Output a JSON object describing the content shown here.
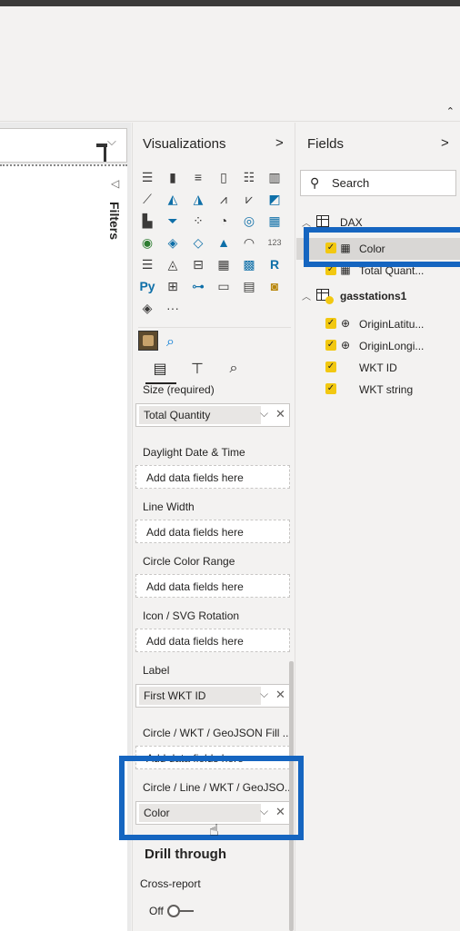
{
  "ribbon": {
    "collapse_icon": "chevron-up-icon"
  },
  "filters": {
    "label": "Filters",
    "caret_icon": "chevron-left-icon"
  },
  "visualizations": {
    "title": "Visualizations",
    "chevron_icon": "chevron-right-icon",
    "more_label": "···",
    "search_icon": "search-icon",
    "tabs": [
      "fields-tab-icon",
      "format-paintroller-icon",
      "analytics-magnifier-icon"
    ],
    "wells": {
      "size": {
        "label": "Size (required)",
        "value": "Total Quantity"
      },
      "daylight": {
        "label": "Daylight Date & Time",
        "placeholder": "Add data fields here"
      },
      "line_width": {
        "label": "Line Width",
        "placeholder": "Add data fields here"
      },
      "circle_color_range": {
        "label": "Circle Color Range",
        "placeholder": "Add data fields here"
      },
      "icon_rotation": {
        "label": "Icon / SVG Rotation",
        "placeholder": "Add data fields here"
      },
      "label": {
        "label": "Label",
        "value": "First WKT ID"
      },
      "fill": {
        "label": "Circle / WKT / GeoJSON Fill ...",
        "placeholder": "Add data fields here"
      },
      "line_color": {
        "label": "Circle / Line / WKT / GeoJSO...",
        "value": "Color"
      }
    },
    "drill_through": {
      "title": "Drill through",
      "cross_report": "Cross-report",
      "toggle_state": "Off"
    }
  },
  "fields": {
    "title": "Fields",
    "chevron_icon": "chevron-right-icon",
    "search_placeholder": "Search",
    "tables": [
      {
        "name": "DAX",
        "items": [
          {
            "name": "Color",
            "checked": true,
            "type": "calculator-icon"
          },
          {
            "name": "Total Quant...",
            "checked": true,
            "type": "calculator-icon"
          }
        ]
      },
      {
        "name": "gasstations1",
        "items": [
          {
            "name": "OriginLatitu...",
            "checked": true,
            "type": "globe-icon"
          },
          {
            "name": "OriginLongi...",
            "checked": true,
            "type": "globe-icon"
          },
          {
            "name": "WKT ID",
            "checked": true,
            "type": ""
          },
          {
            "name": "WKT string",
            "checked": true,
            "type": ""
          }
        ]
      }
    ]
  },
  "colors": {
    "highlight": "#1565c0",
    "checkbox": "#f2c811"
  }
}
